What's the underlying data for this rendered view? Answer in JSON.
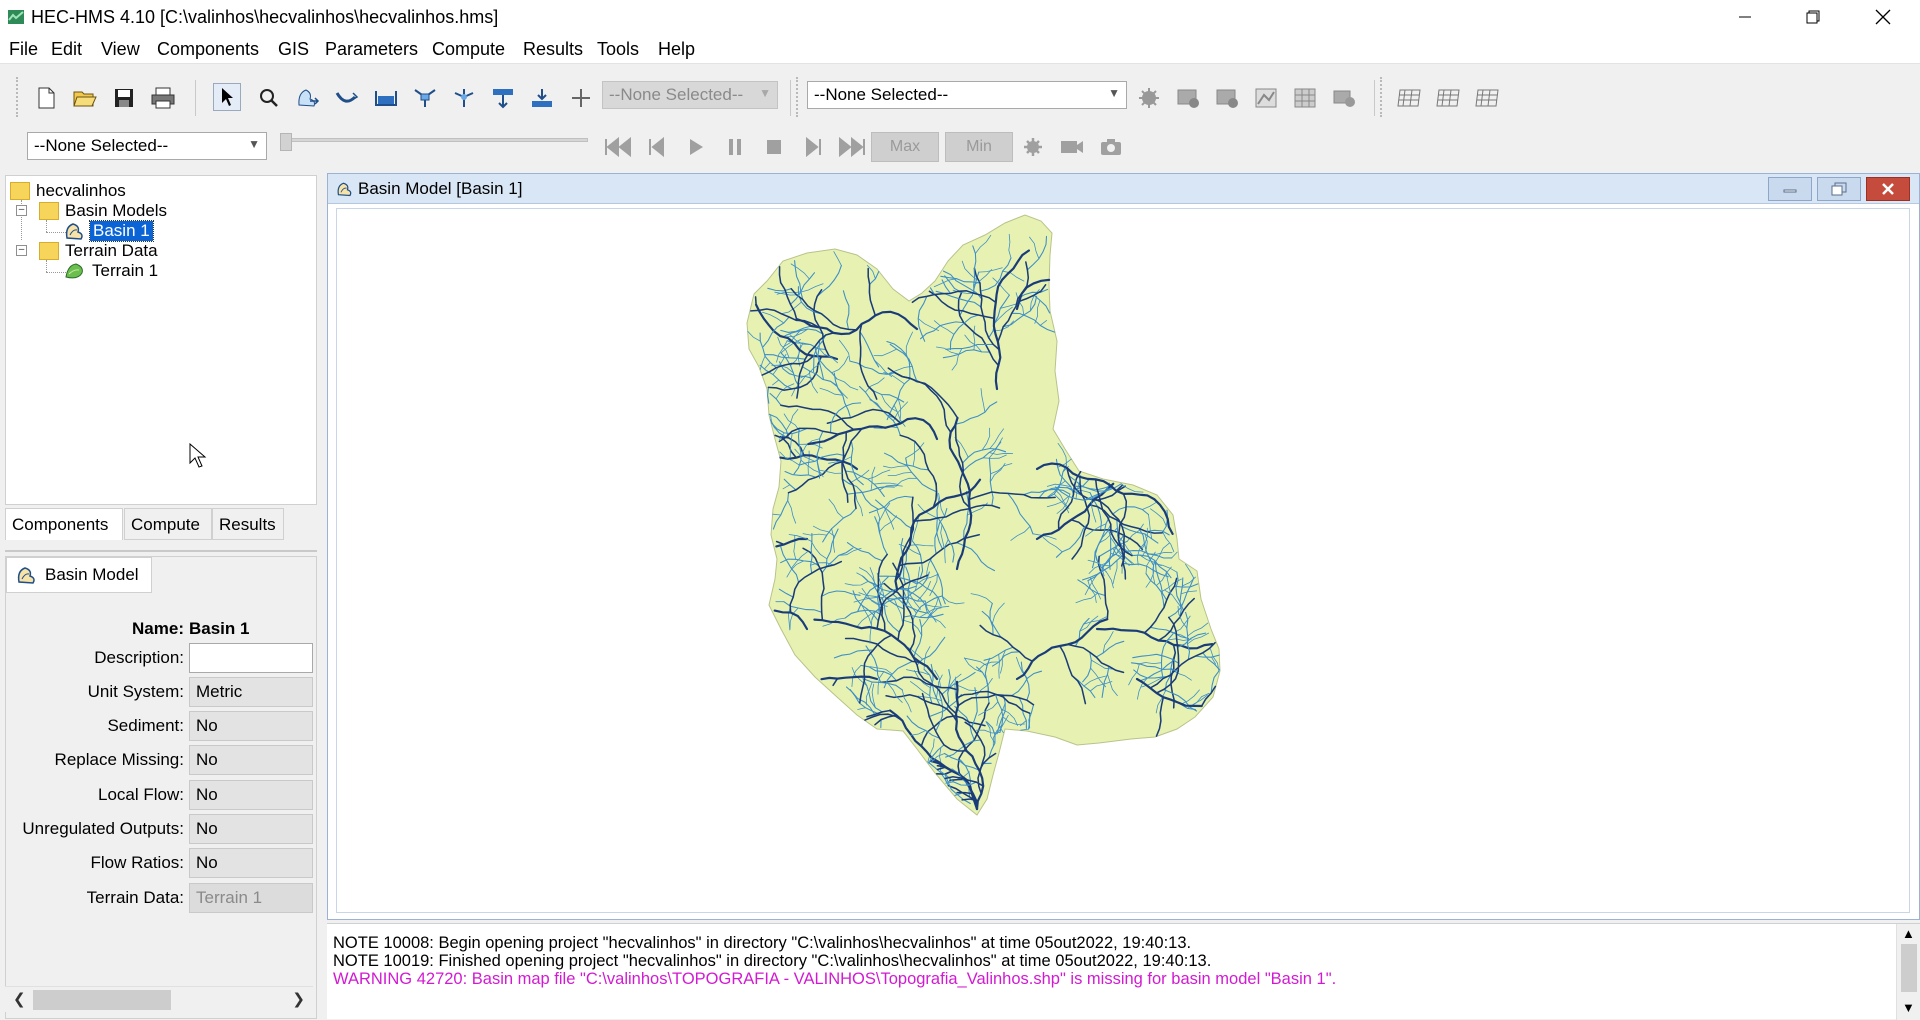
{
  "window": {
    "title": "HEC-HMS 4.10 [C:\\valinhos\\hecvalinhos\\hecvalinhos.hms]",
    "app_icon": "hec-hms-icon",
    "controls": [
      "minimize-icon",
      "restore-icon",
      "close-icon"
    ]
  },
  "menu": [
    "File",
    "Edit",
    "View",
    "Components",
    "GIS",
    "Parameters",
    "Compute",
    "Results",
    "Tools",
    "Help"
  ],
  "toolbar": {
    "file_icons": [
      "new-file-icon",
      "open-folder-icon",
      "save-icon",
      "print-icon"
    ],
    "tool_icons": [
      "arrow-pointer-icon",
      "zoom-icon",
      "subbasin-icon",
      "reach-icon",
      "reservoir-icon",
      "junction-icon",
      "diversion-icon",
      "source-icon",
      "sink-icon",
      "crosshair-icon"
    ],
    "element_select": "--None Selected--",
    "run_select": "--None Selected--",
    "run_icons": [
      "compute-icon",
      "results-1-icon",
      "results-2-icon",
      "graph-icon",
      "table-icon",
      "summary-icon"
    ],
    "grid_icons": [
      "grid-1-icon",
      "grid-2-icon",
      "grid-3-icon"
    ],
    "animation_select": "--None Selected--",
    "anim_icons": [
      "first-frame-icon",
      "previous-frame-icon",
      "play-icon",
      "pause-icon",
      "stop-icon",
      "next-frame-icon",
      "last-frame-icon"
    ],
    "max_label": "Max",
    "min_label": "Min",
    "extra_icons": [
      "settings-icon",
      "video-icon",
      "camera-icon"
    ]
  },
  "tree": {
    "root": "hecvalinhos",
    "basin_models_label": "Basin Models",
    "basin_1": "Basin 1",
    "terrain_data_label": "Terrain Data",
    "terrain_1": "Terrain 1"
  },
  "tabs": [
    "Components",
    "Compute",
    "Results"
  ],
  "properties": {
    "tab_label": "Basin Model",
    "name_label": "Name:",
    "name_value": "Basin 1",
    "description_label": "Description:",
    "description_value": "",
    "unit_system_label": "Unit System:",
    "unit_system_value": "Metric",
    "sediment_label": "Sediment:",
    "sediment_value": "No",
    "replace_missing_label": "Replace Missing:",
    "replace_missing_value": "No",
    "local_flow_label": "Local Flow:",
    "local_flow_value": "No",
    "unregulated_label": "Unregulated Outputs:",
    "unregulated_value": "No",
    "flow_ratios_label": "Flow Ratios:",
    "flow_ratios_value": "No",
    "terrain_label": "Terrain Data:",
    "terrain_value": "Terrain 1"
  },
  "basin_window": {
    "title": "Basin Model [Basin 1]",
    "map_icon": "basin-map-icon"
  },
  "console": {
    "note1": "NOTE 10008:  Begin opening project \"hecvalinhos\" in directory \"C:\\valinhos\\hecvalinhos\" at time 05out2022, 19:40:13.",
    "note2": "NOTE 10019:  Finished opening project \"hecvalinhos\" in directory \"C:\\valinhos\\hecvalinhos\" at time 05out2022, 19:40:13.",
    "warning": "WARNING 42720:  Basin map file \"C:\\valinhos\\TOPOGRAFIA - VALINHOS\\Topografia_Valinhos.shp\" is missing for basin model \"Basin 1\"."
  },
  "colors": {
    "map_fill": "#e7f2b2",
    "stream": "#1a3d7a",
    "stream_light": "#3c8fc8",
    "warning": "#d21ad2",
    "selection": "#0a64d6"
  }
}
